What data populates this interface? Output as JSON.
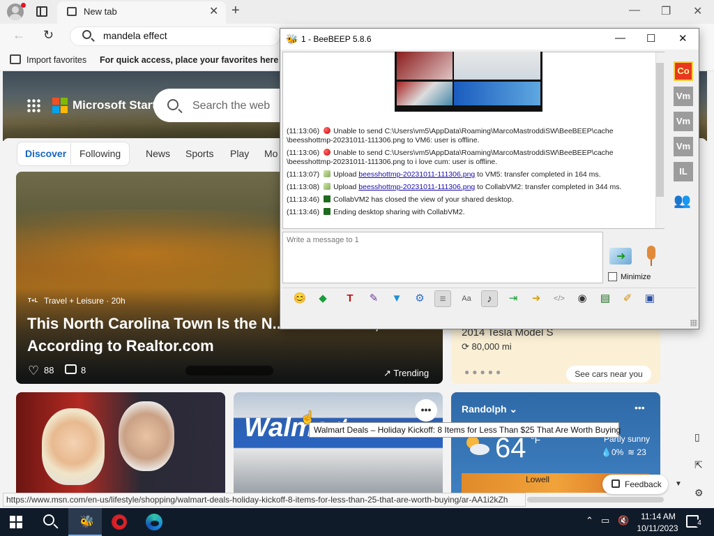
{
  "browser": {
    "tab_title": "New tab",
    "address_text": "mandela effect",
    "favbar": {
      "import_label": "Import favorites",
      "hint": "For quick access, place your favorites here on th"
    }
  },
  "msn": {
    "brand": "Microsoft Start",
    "search_placeholder": "Search the web",
    "feed_tabs": [
      "Discover",
      "Following"
    ],
    "nav_links": [
      "News",
      "Sports",
      "Play",
      "Mo"
    ],
    "main_card": {
      "source": "Travel + Leisure · 20h",
      "headline": "This North Carolina Town Is the N... for Retirees, According to Realtor.com",
      "likes": "88",
      "comments": "8",
      "trending": "Trending"
    },
    "tesla_card": {
      "title": "2014 Tesla Model S",
      "miles": "80,000 mi",
      "cta": "See cars near you"
    },
    "weather_card": {
      "city": "Randolph",
      "temp": "64",
      "unit": "°F",
      "condition": "Partly sunny",
      "precip": "0%",
      "humidity": "23",
      "map_city": "Lowell"
    },
    "walmart_sign": "Walmart",
    "tooltip": "Walmart Deals – Holiday Kickoff: 8 Items for Less Than $25 That Are Worth Buying",
    "feedback": "Feedback",
    "status_url": "https://www.msn.com/en-us/lifestyle/shopping/walmart-deals-holiday-kickoff-8-items-for-less-than-25-that-are-worth-buying/ar-AA1i2kZh"
  },
  "beebeep": {
    "title": "1 - BeeBEEP 5.8.6",
    "log": [
      {
        "time": "(11:13:06)",
        "icon": "red",
        "text": "Unable to send C:\\Users\\vm5\\AppData\\Roaming\\MarcoMastroddiSW\\BeeBEEP\\cache",
        "text2": "\\beesshottmp-20231011-111306.png to VM6: user is offline."
      },
      {
        "time": "(11:13:06)",
        "icon": "red",
        "text": "Unable to send C:\\Users\\vm5\\AppData\\Roaming\\MarcoMastroddiSW\\BeeBEEP\\cache",
        "text2": "\\beesshottmp-20231011-111306.png to i love cum: user is offline."
      },
      {
        "time": "(11:13:07)",
        "icon": "upload",
        "pre": "Upload ",
        "link": "beesshottmp-20231011-111306.png",
        "post": " to VM5: transfer completed in 164 ms."
      },
      {
        "time": "(11:13:08)",
        "icon": "upload",
        "pre": "Upload ",
        "link": "beesshottmp-20231011-111306.png",
        "post": " to CollabVM2: transfer completed in 344 ms."
      },
      {
        "time": "(11:13:46)",
        "icon": "screen",
        "text": "CollabVM2 has closed the view of your shared desktop."
      },
      {
        "time": "(11:13:46)",
        "icon": "screen",
        "text": "Ending desktop sharing with CollabVM2."
      }
    ],
    "input_placeholder": "Write a message to 1",
    "minimize_label": "Minimize",
    "users": [
      "Co",
      "Vm",
      "Vm",
      "Vm",
      "IL"
    ]
  },
  "taskbar": {
    "time": "11:14 AM",
    "date": "10/11/2023",
    "notification_count": "4"
  }
}
